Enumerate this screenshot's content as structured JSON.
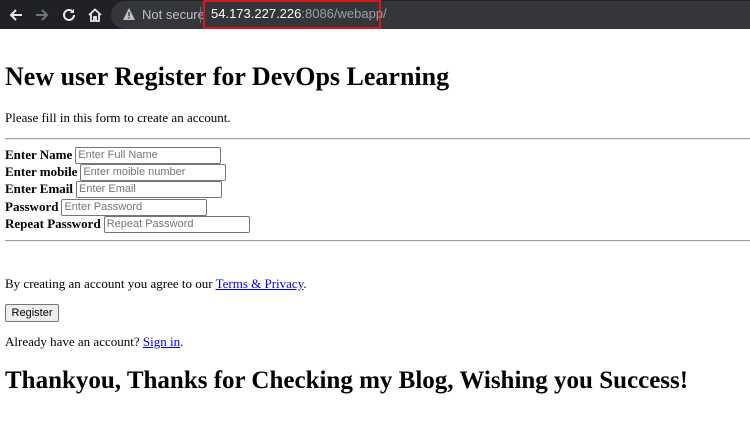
{
  "browser": {
    "security_label": "Not secure",
    "url_host": "54.173.227.226",
    "url_rest": ":8086/webapp/",
    "highlight_color": "#d8161d"
  },
  "page": {
    "title": "New user Register for DevOps Learning",
    "intro": "Please fill in this form to create an account.",
    "form": {
      "name_label": "Enter Name",
      "name_placeholder": "Enter Full Name",
      "mobile_label": "Enter mobile",
      "mobile_placeholder": "Enter moible number",
      "email_label": "Enter Email",
      "email_placeholder": "Enter Email",
      "password_label": "Password",
      "password_placeholder": "Enter Password",
      "repeat_label": "Repeat Password",
      "repeat_placeholder": "Repeat Password"
    },
    "agree_prefix": "By creating an account you agree to our ",
    "terms_link": "Terms & Privacy",
    "agree_suffix": ".",
    "register_button": "Register",
    "signin_prefix": "Already have an account? ",
    "signin_link": "Sign in",
    "signin_suffix": ".",
    "footer_heading": "Thankyou, Thanks for Checking my Blog, Wishing you Success!"
  }
}
